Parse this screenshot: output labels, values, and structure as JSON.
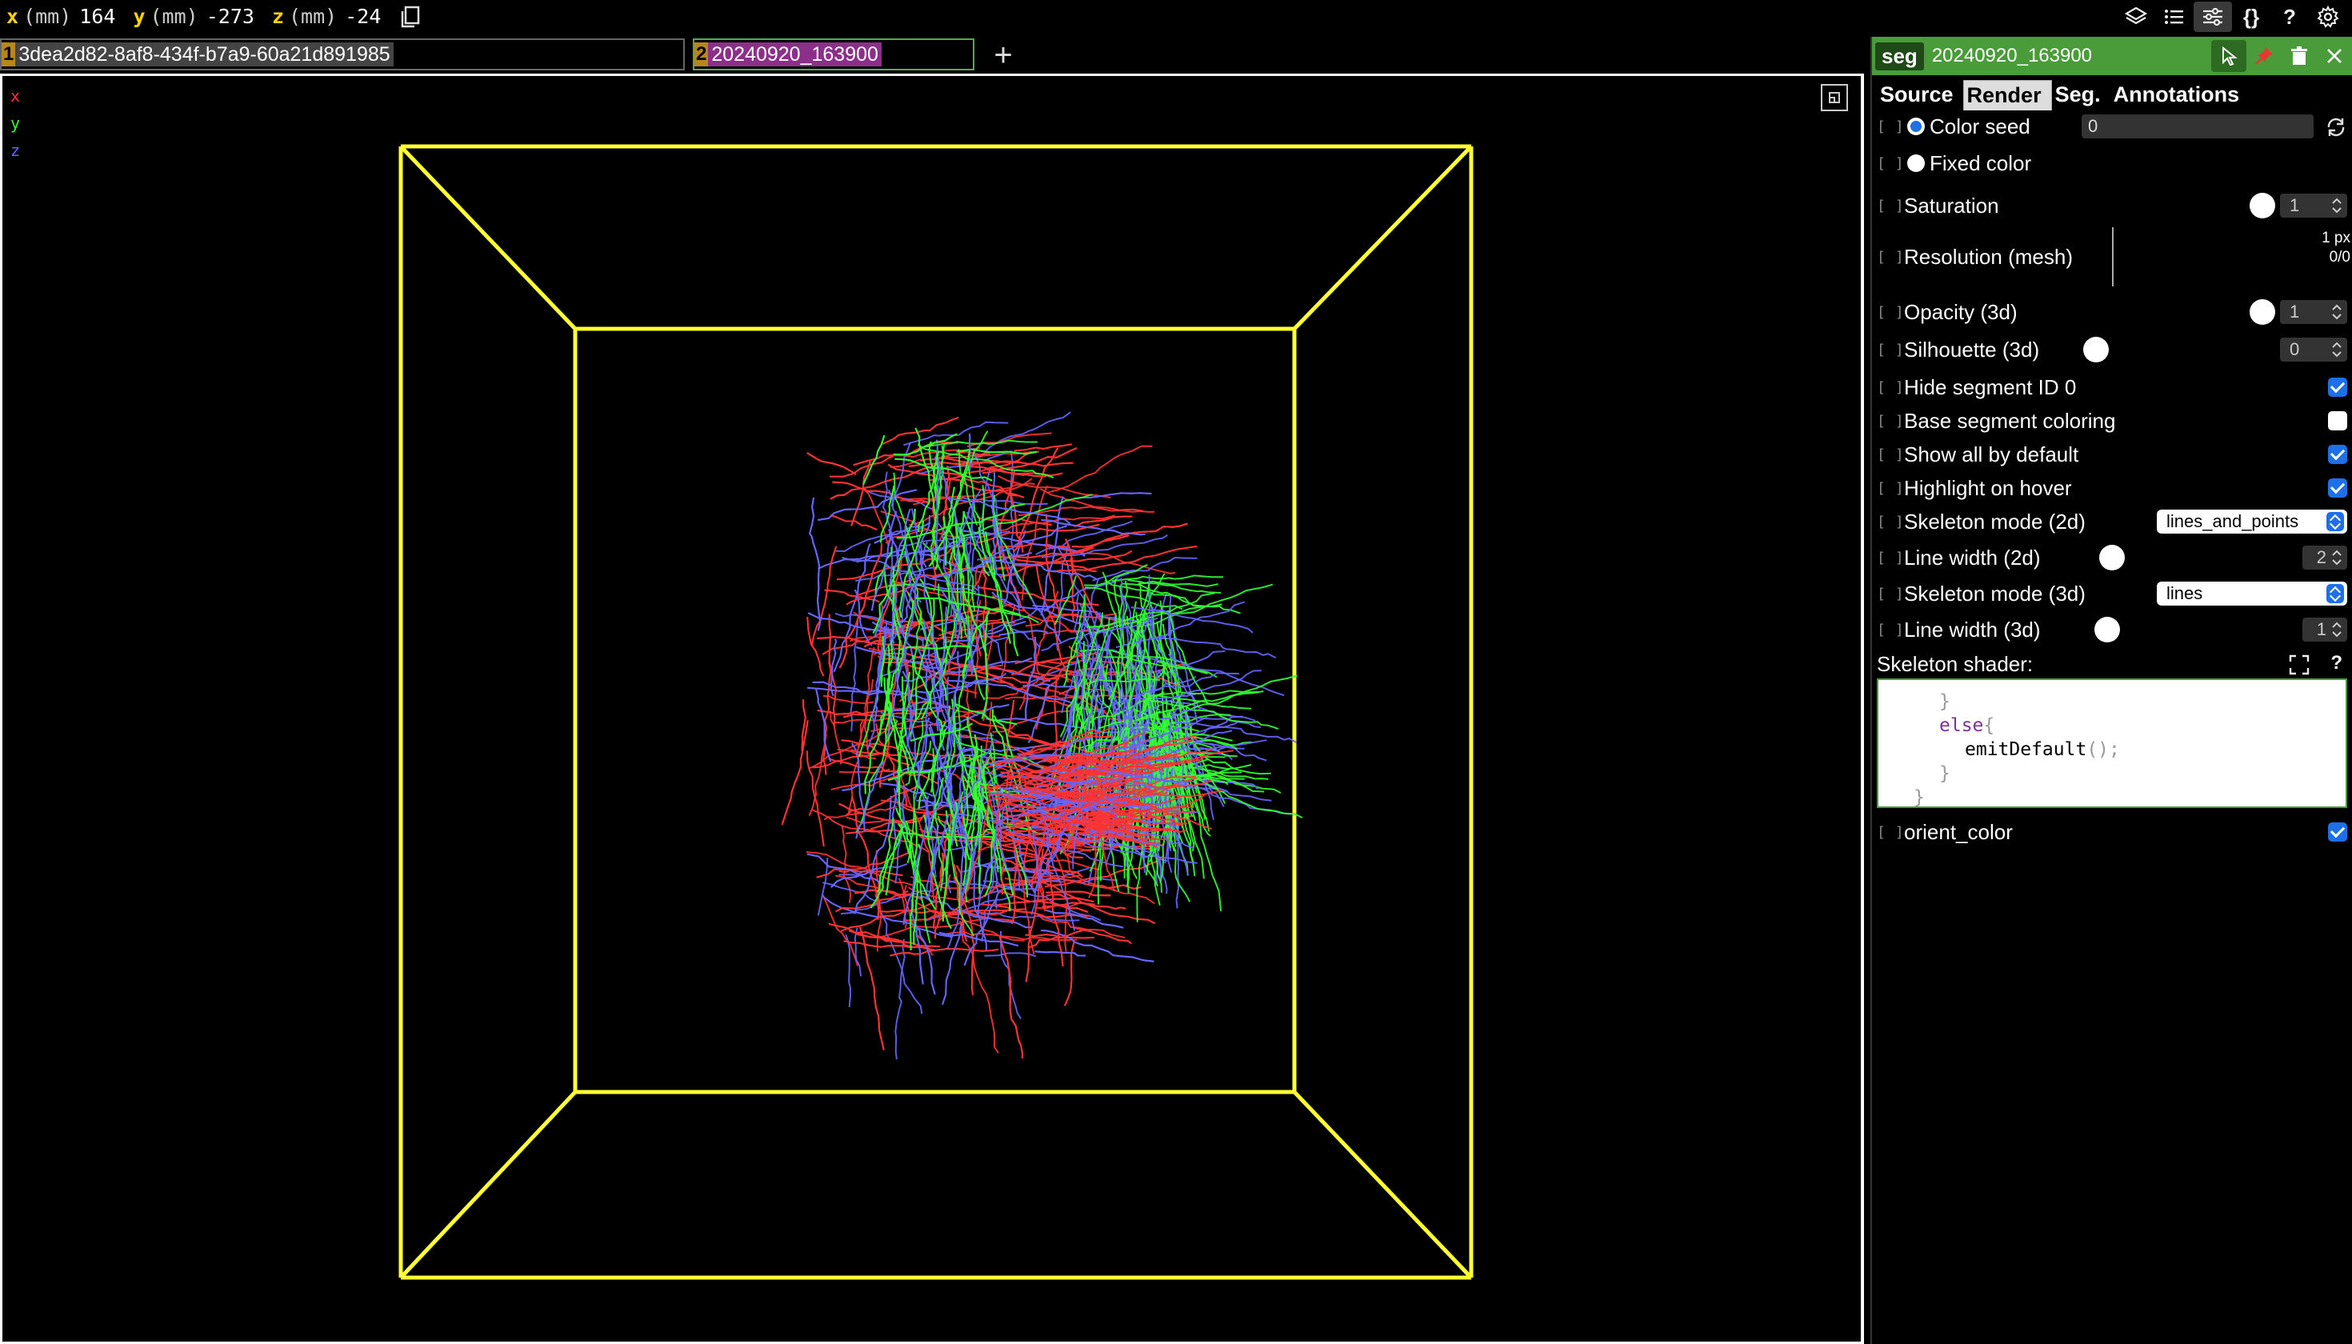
{
  "coords": {
    "x": {
      "axis": "x",
      "unit": "(mm)",
      "value": "164"
    },
    "y": {
      "axis": "y",
      "unit": "(mm)",
      "value": "-273"
    },
    "z": {
      "axis": "z",
      "unit": "(mm)",
      "value": "-24"
    }
  },
  "top_icons": [
    "layers-icon",
    "list-icon",
    "sliders-icon",
    "braces-icon",
    "help-icon",
    "settings-icon"
  ],
  "top_icon_text": {
    "braces": "{}",
    "help": "?"
  },
  "layers": [
    {
      "index": "1",
      "name": "3dea2d82-8af8-434f-b7a9-60a21d891985"
    },
    {
      "index": "2",
      "name": "20240920_163900"
    }
  ],
  "add_layer": "+",
  "viewer": {
    "axis_labels": {
      "x": "x",
      "y": "y",
      "z": "z"
    },
    "axis_colors": {
      "x": "#ff3333",
      "y": "#33ff33",
      "z": "#6666ff"
    },
    "box_color": "#ffff33"
  },
  "panel": {
    "type_label": "seg",
    "title": "20240920_163900",
    "tabs": [
      "Source",
      "Render",
      "Seg.",
      "Annotations"
    ],
    "active_tab": "Render",
    "props": {
      "color_seed": {
        "label": "Color seed",
        "value": "0"
      },
      "fixed_color": {
        "label": "Fixed color"
      },
      "saturation": {
        "label": "Saturation",
        "value": "1"
      },
      "resolution": {
        "label": "Resolution (mesh)",
        "px": "1 px",
        "ratio": "0/0"
      },
      "opacity3d": {
        "label": "Opacity (3d)",
        "value": "1"
      },
      "silhouette3d": {
        "label": "Silhouette (3d)",
        "value": "0"
      },
      "hide_seg0": {
        "label": "Hide segment ID 0",
        "checked": true
      },
      "base_coloring": {
        "label": "Base segment coloring",
        "checked": false
      },
      "show_all": {
        "label": "Show all by default",
        "checked": true
      },
      "highlight": {
        "label": "Highlight on hover",
        "checked": true
      },
      "skel_mode_2d": {
        "label": "Skeleton mode (2d)",
        "value": "lines_and_points"
      },
      "line_width_2d": {
        "label": "Line width (2d)",
        "value": "2"
      },
      "skel_mode_3d": {
        "label": "Skeleton mode (3d)",
        "value": "lines"
      },
      "line_width_3d": {
        "label": "Line width (3d)",
        "value": "1"
      },
      "shader_label": "Skeleton shader:",
      "shader_help": "?",
      "orient_color": {
        "label": "orient_color",
        "checked": true
      }
    },
    "shader_code": {
      "l1": "}",
      "l2_kw": "else",
      "l2_p": "{",
      "l3_fn": "emitDefault",
      "l3_p": "();",
      "l4": "}",
      "l5": "}"
    },
    "accent": "#4a9b3a",
    "checkbox_blue": "#1e6fe8"
  }
}
